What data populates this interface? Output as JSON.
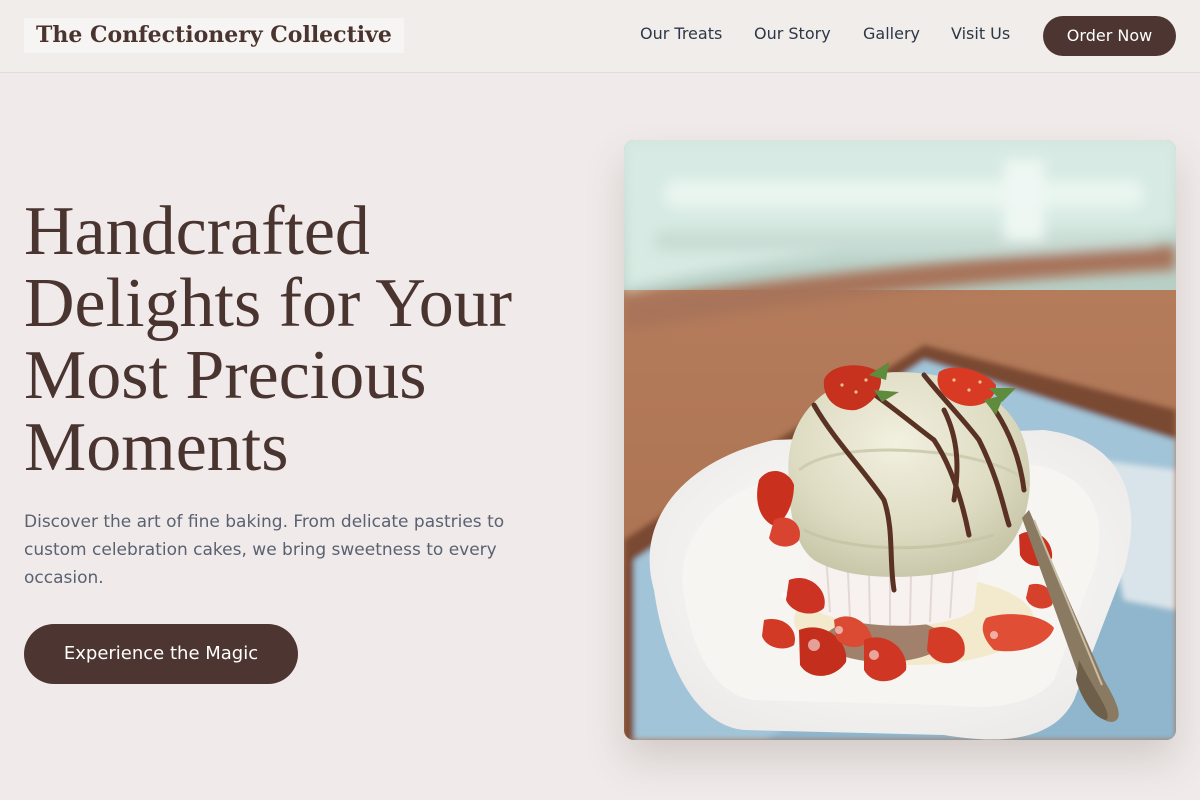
{
  "brand": {
    "name": "The Confectionery Collective"
  },
  "nav": {
    "links": [
      "Our Treats",
      "Our Story",
      "Gallery",
      "Visit Us"
    ],
    "cta": "Order Now"
  },
  "hero": {
    "title_lines": [
      "Handcrafted",
      "Delights for Your",
      "Most Precious",
      "Moments"
    ],
    "subtitle": "Discover the art of fine baking. From delicate pastries to custom celebration cakes, we bring sweetness to every occasion.",
    "button": "Experience the Magic",
    "image": {
      "subject": "ice-cream-dessert-photo"
    }
  },
  "colors": {
    "primary": "#4d3531",
    "background": "#f0ebea",
    "header_bg": "#f0edea",
    "text_muted": "#5a6170"
  }
}
